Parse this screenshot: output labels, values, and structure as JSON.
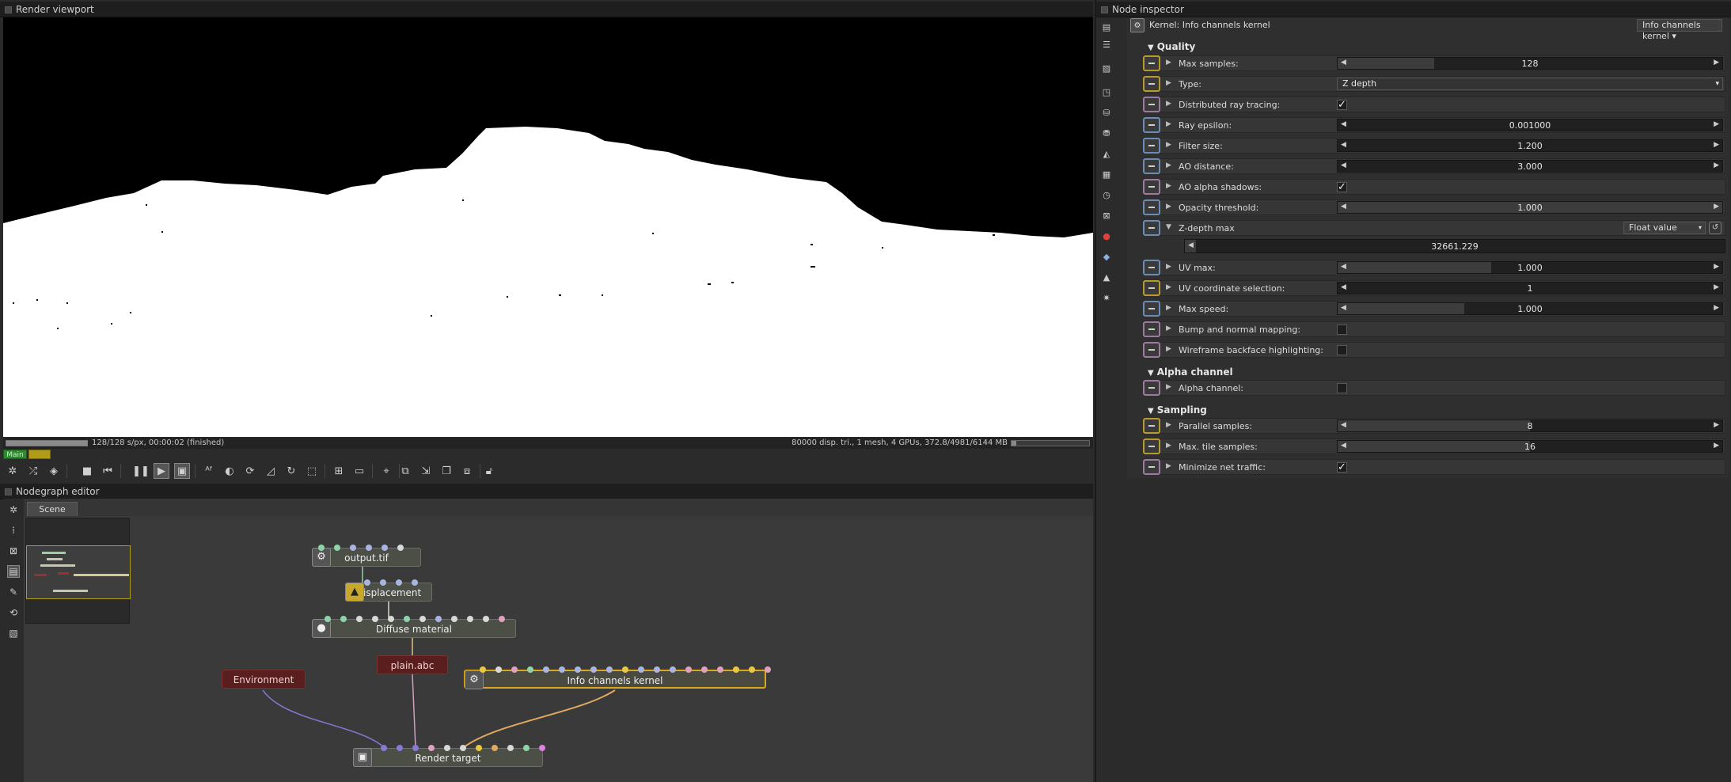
{
  "render_viewport": {
    "title": "Render viewport",
    "status_left": "128/128 s/px, 00:00:02 (finished)",
    "status_right": "80000 disp. tri., 1 mesh, 4 GPUs, 372.8/4981/6144 MB",
    "progress": 1.0,
    "memory_fraction": 0.06,
    "main_tab_label": "Main"
  },
  "nodegraph": {
    "title": "Nodegraph editor",
    "tab_label": "Scene",
    "nodes": {
      "output_tif": "output.tif",
      "displacement": "Displacement",
      "diffuse_material": "Diffuse material",
      "plain_abc": "plain.abc",
      "environment": "Environment",
      "info_channels_kernel": "Info channels kernel",
      "render_target": "Render target"
    }
  },
  "inspector": {
    "title": "Node inspector",
    "kernel_label": "Kernel: Info channels kernel",
    "kernel_dropdown": "Info channels kernel",
    "sections": {
      "quality": "Quality",
      "alpha": "Alpha channel",
      "sampling": "Sampling"
    },
    "params": {
      "max_samples": {
        "label": "Max samples:",
        "value": "128",
        "fill": 0.25
      },
      "type": {
        "label": "Type:",
        "value": "Z depth"
      },
      "distributed": {
        "label": "Distributed ray tracing:",
        "checked": "✓"
      },
      "ray_epsilon": {
        "label": "Ray epsilon:",
        "value": "0.001000",
        "fill": 0.0
      },
      "filter_size": {
        "label": "Filter size:",
        "value": "1.200",
        "fill": 0.0
      },
      "ao_distance": {
        "label": "AO distance:",
        "value": "3.000",
        "fill": 0.0
      },
      "ao_alpha": {
        "label": "AO alpha shadows:",
        "checked": "✓"
      },
      "opacity": {
        "label": "Opacity threshold:",
        "value": "1.000",
        "fill": 1.0
      },
      "zdepth": {
        "label": "Z-depth max",
        "mode": "Float value",
        "value": "32661.229",
        "fill": 0.02
      },
      "uv_max": {
        "label": "UV max:",
        "value": "1.000",
        "fill": 0.4
      },
      "uv_coord": {
        "label": "UV coordinate selection:",
        "value": "1",
        "fill": 0.0
      },
      "max_speed": {
        "label": "Max speed:",
        "value": "1.000",
        "fill": 0.33
      },
      "bump": {
        "label": "Bump and normal mapping:",
        "checked": ""
      },
      "wireframe": {
        "label": "Wireframe backface highlighting:",
        "checked": ""
      },
      "alpha_channel": {
        "label": "Alpha channel:",
        "checked": ""
      },
      "parallel": {
        "label": "Parallel samples:",
        "value": "8",
        "fill": 0.5
      },
      "max_tile": {
        "label": "Max. tile samples:",
        "value": "16",
        "fill": 0.5
      },
      "minimize": {
        "label": "Minimize net traffic:",
        "checked": "✓"
      }
    }
  },
  "colors": {
    "main_tab": "#2e8a2e",
    "selected_node": "#d9a820",
    "param_yellow": "#b89a2e",
    "param_blue": "#6b8db5",
    "param_purple": "#9d7aa0"
  }
}
